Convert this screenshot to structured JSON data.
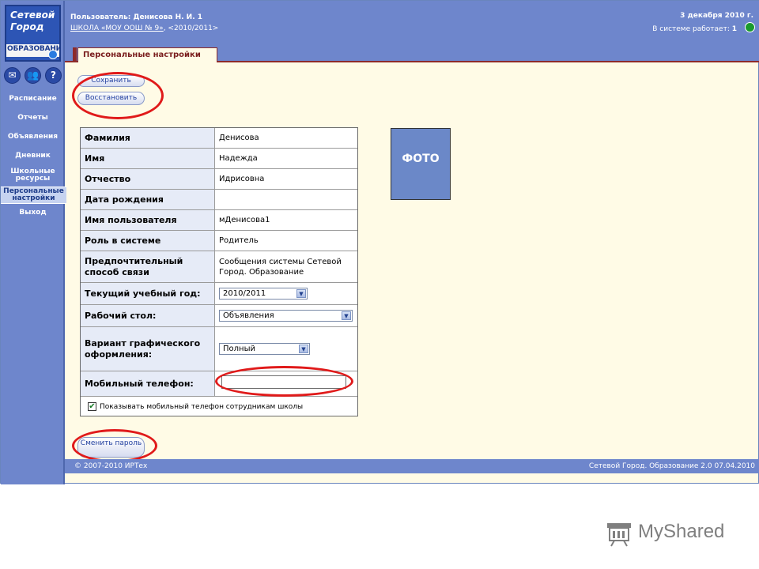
{
  "logo": {
    "line1": "Сетевой",
    "line2": "Город",
    "line3": "ОБРАЗОВАНИ"
  },
  "side_icons": [
    {
      "name": "mail-icon",
      "glyph": "✉"
    },
    {
      "name": "users-icon",
      "glyph": "👥"
    },
    {
      "name": "help-icon",
      "glyph": "?"
    }
  ],
  "sidebar": {
    "items": [
      {
        "label": "Расписание"
      },
      {
        "label": "Отчеты"
      },
      {
        "label": "Объявления"
      },
      {
        "label": "Дневник"
      },
      {
        "label": "Школьные ресурсы"
      },
      {
        "label": "Персональные настройки",
        "active": true
      },
      {
        "label": "Выход"
      }
    ]
  },
  "header": {
    "user": "Пользователь: Денисова Н. И. 1",
    "school_link": "ШКОЛА «МОУ ООШ № 9»",
    "school_rest": ", <2010/2011>",
    "date": "3 декабря 2010 г.",
    "online_label": "В системе работает:",
    "online_count": "1"
  },
  "tab": {
    "label": "Персональные настройки"
  },
  "buttons": {
    "save": "Сохранить",
    "restore": "Восстановить",
    "change_password": "Сменить пароль"
  },
  "form": {
    "rows": [
      {
        "label": "Фамилия",
        "value": "Денисова"
      },
      {
        "label": "Имя",
        "value": "Надежда"
      },
      {
        "label": "Отчество",
        "value": "Идрисовна"
      },
      {
        "label": "Дата рождения",
        "value": ""
      },
      {
        "label": "Имя пользователя",
        "value": "мДенисова1"
      },
      {
        "label": "Роль в системе",
        "value": "Родитель"
      },
      {
        "label": "Предпочтительный способ связи",
        "value": "Сообщения системы Сетевой Город. Образование"
      },
      {
        "label": "Текущий учебный год:",
        "value": "2010/2011"
      },
      {
        "label": "Рабочий стол:",
        "value": "Объявления"
      },
      {
        "label": "Вариант графического оформления:",
        "value": "Полный"
      },
      {
        "label": "Мобильный телефон:",
        "value": ""
      }
    ],
    "show_phone_label": "Показывать мобильный телефон сотрудникам школы",
    "show_phone_checked": true
  },
  "photo": {
    "label": "ФОТО"
  },
  "footer": {
    "copyright": "© 2007-2010 ИРТех",
    "version": "Сетевой Город. Образование 2.0   07.04.2010"
  },
  "watermark": {
    "text": "MyShared"
  },
  "colors": {
    "header_blue": "#6e86cc",
    "content_bg": "#fffbe6",
    "tab_accent": "#8d2b2b",
    "highlight_ring": "#e01a1a"
  }
}
